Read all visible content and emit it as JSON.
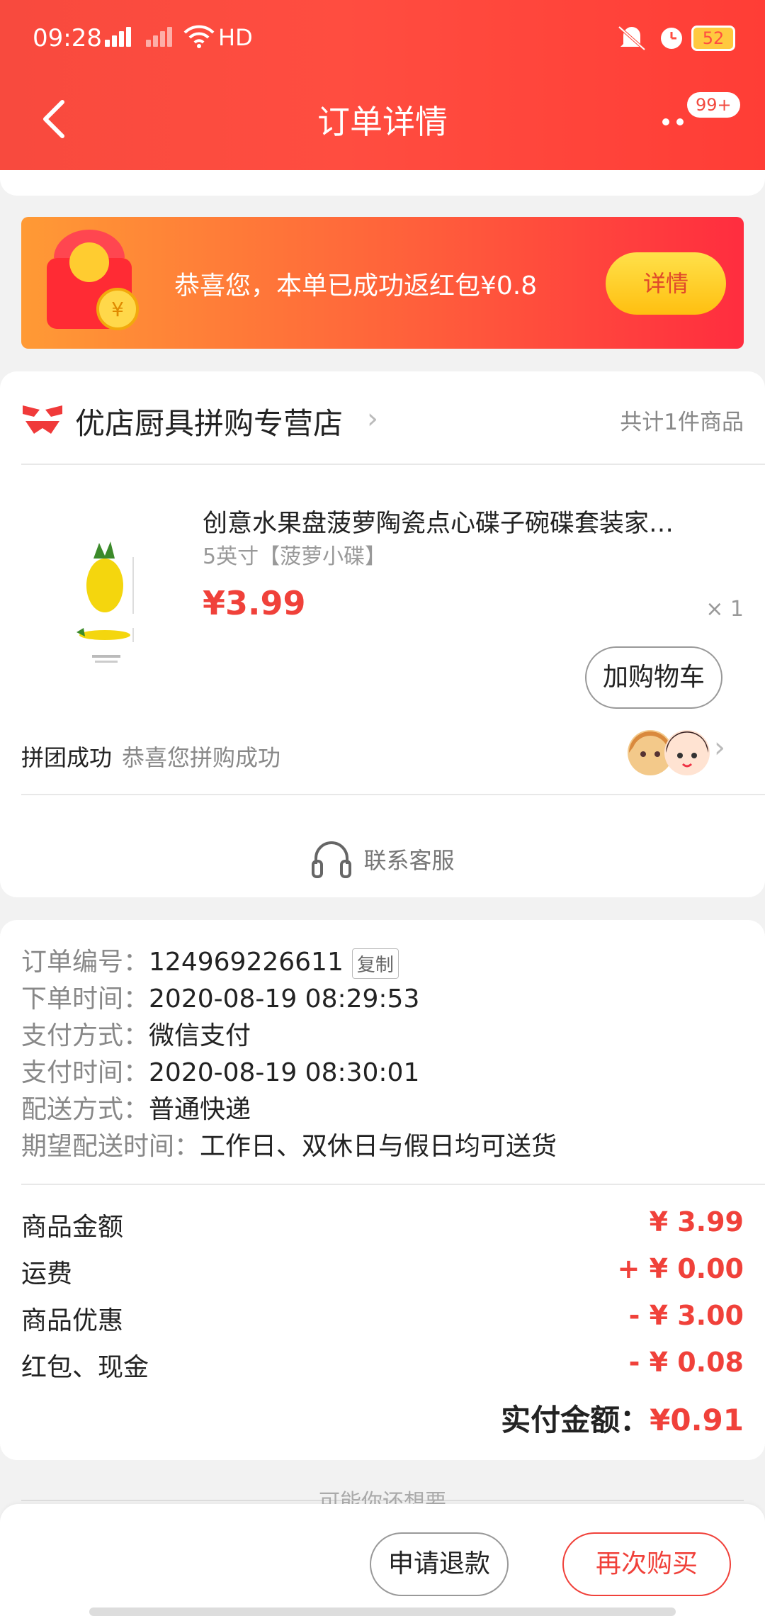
{
  "status": {
    "time": "09:28",
    "network": "HD",
    "battery": "52"
  },
  "header": {
    "title": "订单详情",
    "badge": "99+"
  },
  "promo": {
    "text": "恭喜您，本单已成功返红包¥0.8",
    "button": "详情"
  },
  "store": {
    "name": "优店厨具拼购专营店",
    "item_count": "共计1件商品"
  },
  "product": {
    "title": "创意水果盘菠萝陶瓷点心碟子碗碟套装家…",
    "spec": "5英寸【菠萝小碟】",
    "price": "¥3.99",
    "quantity": "× 1",
    "cart_button": "加购物车"
  },
  "group": {
    "label": "拼团成功",
    "message": "恭喜您拼购成功"
  },
  "service": {
    "label": "联系客服"
  },
  "order_info": {
    "order_no_key": "订单编号：",
    "order_no": "124969226611",
    "copy": "复制",
    "order_time_key": "下单时间：",
    "order_time": "2020-08-19 08:29:53",
    "pay_method_key": "支付方式：",
    "pay_method": "微信支付",
    "pay_time_key": "支付时间：",
    "pay_time": "2020-08-19 08:30:01",
    "delivery_key": "配送方式：",
    "delivery": "普通快递",
    "expect_key": "期望配送时间：",
    "expect": "工作日、双休日与假日均可送货"
  },
  "prices": [
    {
      "label": "商品金额",
      "value": "¥ 3.99"
    },
    {
      "label": "运费",
      "value": "+ ¥ 0.00"
    },
    {
      "label": "商品优惠",
      "value": "- ¥ 3.00"
    },
    {
      "label": "红包、现金",
      "value": "- ¥ 0.08"
    }
  ],
  "total": {
    "label": "实付金额：",
    "value": "¥0.91"
  },
  "recommend": {
    "label": "可能你还想要"
  },
  "bottom": {
    "refund": "申请退款",
    "rebuy": "再次购买"
  },
  "colors": {
    "brand_red": "#f0413a",
    "header_red": "#ff4d40",
    "promo_orange": "#ff9a35",
    "gold_button": "#ffc520"
  }
}
